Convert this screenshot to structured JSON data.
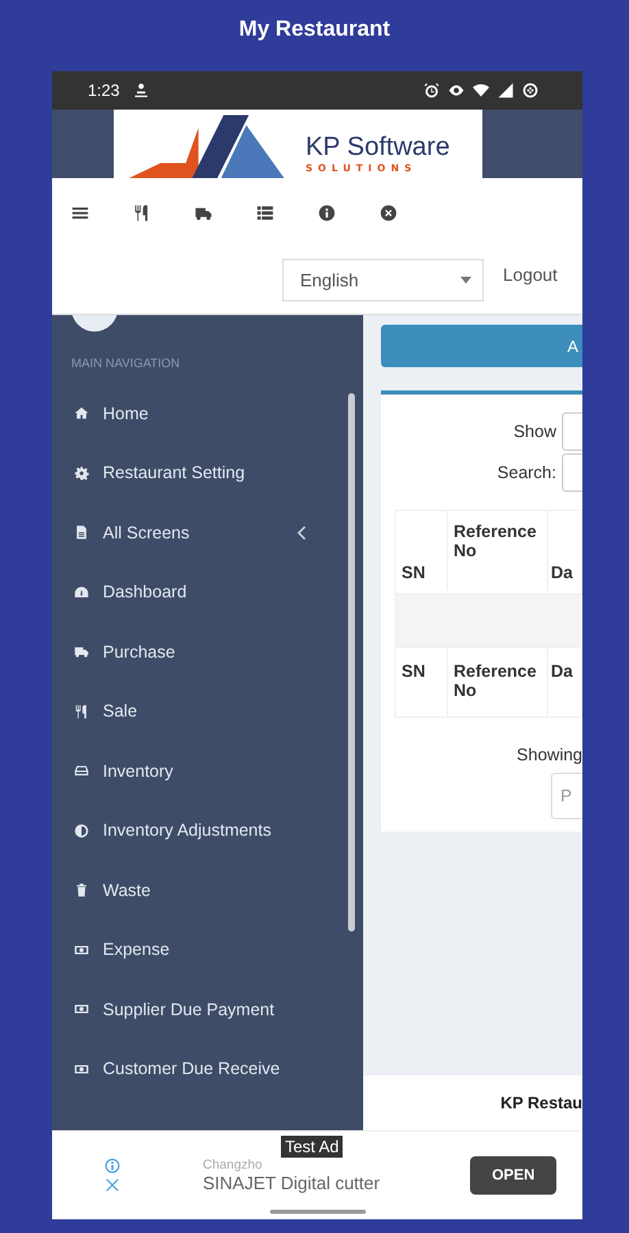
{
  "app_bar": {
    "title": "My Restaurant"
  },
  "status_bar": {
    "time": "1:23"
  },
  "logo": {
    "name": "KP Software",
    "tagline": "SOLUTIONS"
  },
  "toolbar": {
    "icons": [
      {
        "kind": "menu"
      },
      {
        "kind": "cutlery"
      },
      {
        "kind": "truck"
      },
      {
        "kind": "list"
      },
      {
        "kind": "info"
      },
      {
        "kind": "close"
      }
    ]
  },
  "language_select": {
    "value": "English"
  },
  "logout": "Logout",
  "sidebar": {
    "heading": "MAIN NAVIGATION",
    "items": [
      {
        "label": "Home",
        "expandable": false
      },
      {
        "label": "Restaurant Setting",
        "expandable": false
      },
      {
        "label": "All Screens",
        "expandable": true
      },
      {
        "label": "Dashboard",
        "expandable": false
      },
      {
        "label": "Purchase",
        "expandable": false
      },
      {
        "label": "Sale",
        "expandable": false
      },
      {
        "label": "Inventory",
        "expandable": false
      },
      {
        "label": "Inventory Adjustments",
        "expandable": false
      },
      {
        "label": "Waste",
        "expandable": false
      },
      {
        "label": "Expense",
        "expandable": false
      },
      {
        "label": "Supplier Due Payment",
        "expandable": false
      },
      {
        "label": "Customer Due Receive",
        "expandable": false
      }
    ]
  },
  "content": {
    "action_button": "A",
    "show_label": "Show",
    "search_label": "Search:",
    "table": {
      "columns": [
        {
          "label": "SN"
        },
        {
          "label": "Reference No"
        },
        {
          "label": "Da"
        }
      ],
      "footer_columns": [
        {
          "label": "SN"
        },
        {
          "label": "Reference No"
        },
        {
          "label": "Da"
        }
      ]
    },
    "info": "Showing",
    "pagination_button": "P",
    "footer": "KP Restau"
  },
  "ad": {
    "badge": "Test Ad",
    "advertiser": "Changzho",
    "headline": "SINAJET Digital cutter",
    "button": "OPEN"
  }
}
